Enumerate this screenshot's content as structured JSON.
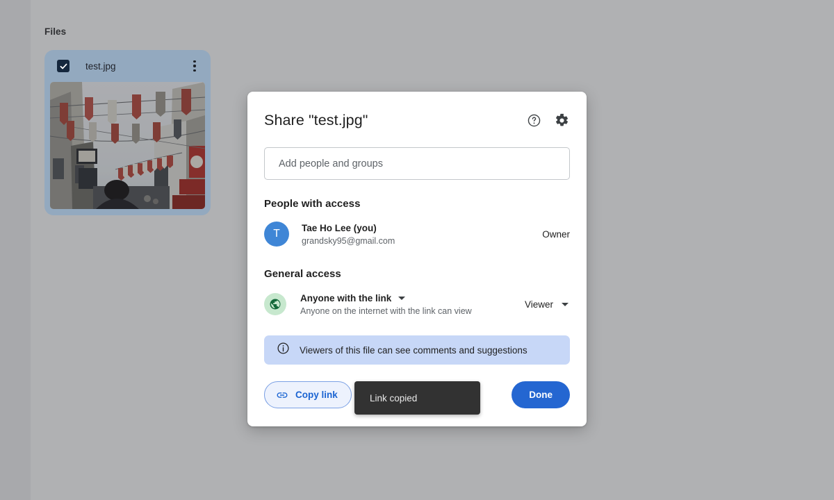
{
  "background": {
    "files_label": "Files",
    "page_bg_color": "#b0b1b3",
    "rail_color": "#a8a9ac"
  },
  "file_card": {
    "name": "test.jpg",
    "selected": true,
    "checkbox_icon": "checkbox-checked-icon",
    "more_icon": "more-vertical-icon",
    "card_color": "#93a9bf",
    "thumbnail_alt": "street scene with hanging banners"
  },
  "dialog": {
    "title": "Share \"test.jpg\"",
    "help_icon": "help-circle-icon",
    "settings_icon": "gear-icon",
    "share_input": {
      "placeholder": "Add people and groups",
      "value": ""
    },
    "people_section": {
      "heading": "People with access",
      "people": [
        {
          "avatar_letter": "T",
          "avatar_color": "#3f86d6",
          "name": "Tae Ho Lee (you)",
          "email": "grandsky95@gmail.com",
          "role": "Owner"
        }
      ]
    },
    "general_access": {
      "heading": "General access",
      "icon": "globe-icon",
      "icon_bg_color": "#c7e8ce",
      "title": "Anyone with the link",
      "subtitle": "Anyone on the internet with the link can view",
      "role": "Viewer",
      "caret_icon": "chevron-down-icon"
    },
    "info_banner": {
      "icon": "info-circle-icon",
      "text": "Viewers of this file can see comments and suggestions",
      "bg_color": "#c7d7f7"
    },
    "footer": {
      "copy_link_label": "Copy link",
      "copy_link_icon": "link-icon",
      "copy_link_color": "#1b64d2",
      "done_label": "Done",
      "done_color": "#2466d1"
    }
  },
  "toast": {
    "message": "Link copied",
    "bg_color": "#323232"
  }
}
